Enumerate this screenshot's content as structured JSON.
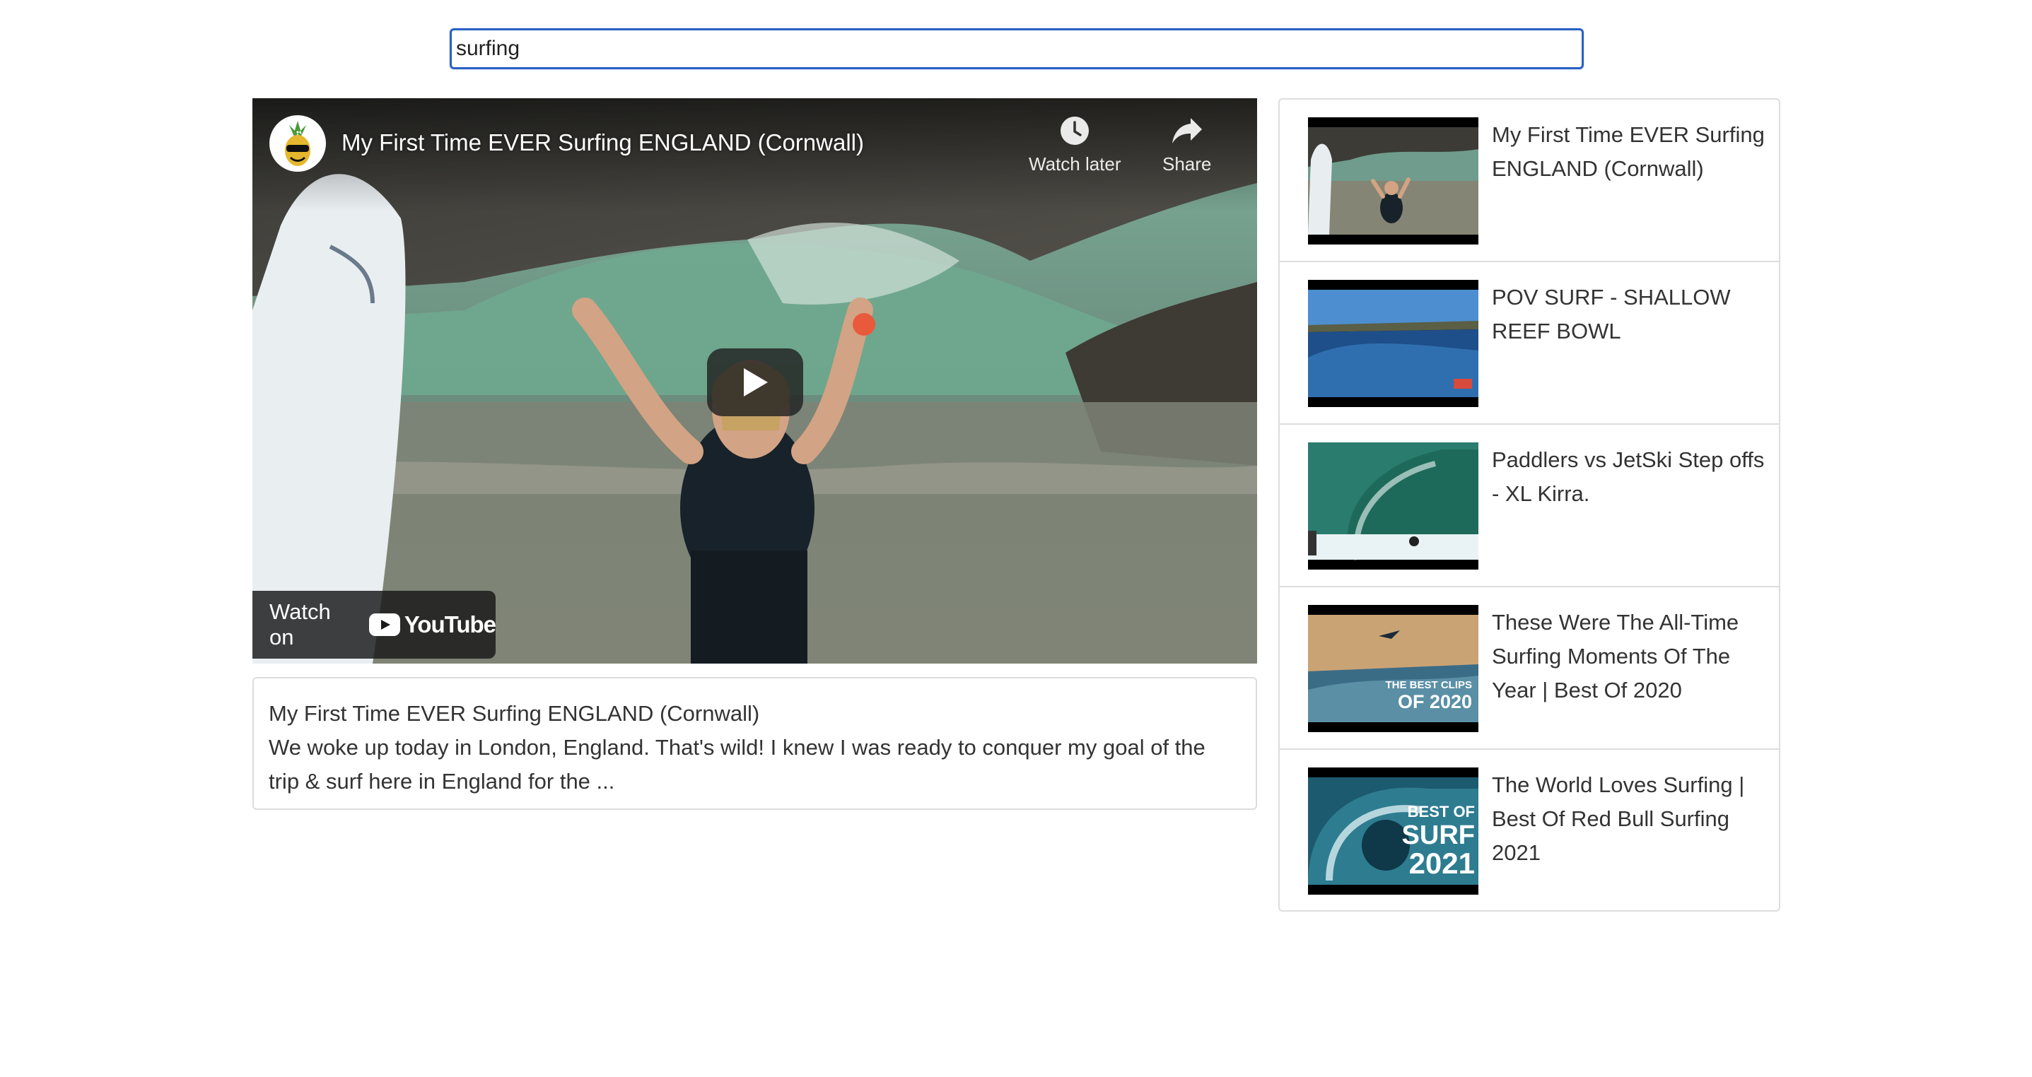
{
  "search": {
    "value": "surfing"
  },
  "player": {
    "title": "My First Time EVER Surfing ENGLAND (Cornwall)",
    "watch_later_label": "Watch later",
    "share_label": "Share",
    "watch_on_label": "Watch on",
    "youtube_label": "YouTube"
  },
  "description": {
    "title": "My First Time EVER Surfing ENGLAND (Cornwall)",
    "text": "We woke up today in London, England. That's wild! I knew I was ready to conquer my goal of the trip & surf here in England for the ..."
  },
  "videos": [
    {
      "title": "My First Time EVER Surfing ENGLAND (Cornwall)"
    },
    {
      "title": "POV SURF - SHALLOW REEF BOWL"
    },
    {
      "title": "Paddlers vs JetSki Step offs - XL Kirra."
    },
    {
      "title": "These Were The All-Time Surfing Moments Of The Year | Best Of 2020",
      "thumb_text": "THE BEST CLIPS OF 2020"
    },
    {
      "title": "The World Loves Surfing | Best Of Red Bull Surfing 2021",
      "thumb_text": "BEST OF SURF 2021"
    }
  ],
  "colors": {
    "accent": "#2a61c5",
    "border": "#dddddd",
    "text": "#333333"
  },
  "icons": [
    "pineapple-avatar-icon",
    "clock-icon",
    "share-arrow-icon",
    "play-icon",
    "youtube-logo-icon"
  ]
}
